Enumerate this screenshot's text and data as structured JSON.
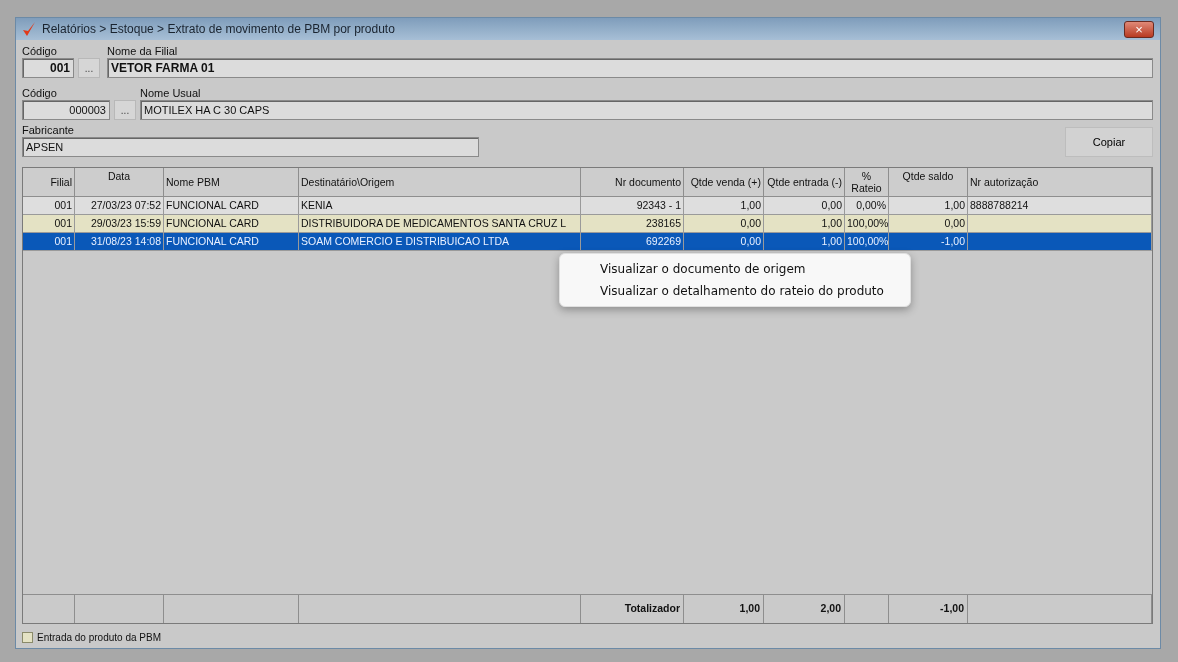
{
  "window": {
    "title": "Relatórios > Estoque > Extrato de movimento de PBM por produto",
    "close": "×"
  },
  "filial": {
    "codigo_label": "Código",
    "codigo": "001",
    "lookup": "...",
    "nome_label": "Nome da Filial",
    "nome": "VETOR FARMA 01"
  },
  "produto": {
    "codigo_label": "Código",
    "codigo": "000003",
    "lookup": "...",
    "nome_label": "Nome Usual",
    "nome": "MOTILEX HA C 30 CAPS",
    "fabricante_label": "Fabricante",
    "fabricante": "APSEN"
  },
  "copy_button": "Copiar",
  "table": {
    "columns": [
      "Filial",
      "Data",
      "Nome PBM",
      "Destinatário\\Origem",
      "Nr documento",
      "Qtde venda (+)",
      "Qtde entrada (-)",
      "% Rateio",
      "Qtde saldo",
      "Nr autorização"
    ],
    "rows": [
      {
        "kind": "saida",
        "selected": false,
        "cells": [
          "001",
          "27/03/23 07:52",
          "FUNCIONAL CARD",
          "KENIA",
          "92343 - 1",
          "1,00",
          "0,00",
          "0,00%",
          "1,00",
          "8888788214"
        ]
      },
      {
        "kind": "entrada",
        "selected": false,
        "cells": [
          "001",
          "29/03/23 15:59",
          "FUNCIONAL CARD",
          "DISTRIBUIDORA DE MEDICAMENTOS SANTA CRUZ L",
          "238165",
          "0,00",
          "1,00",
          "100,00%",
          "0,00",
          ""
        ]
      },
      {
        "selected": true,
        "cells": [
          "001",
          "31/08/23 14:08",
          "FUNCIONAL CARD",
          "SOAM COMERCIO E DISTRIBUICAO LTDA",
          "692269",
          "0,00",
          "1,00",
          "100,00%",
          "-1,00",
          ""
        ]
      }
    ],
    "totals": {
      "label": "Totalizador",
      "qtde_venda": "1,00",
      "qtde_entrada": "2,00",
      "qtde_saldo": "-1,00"
    }
  },
  "legend": {
    "label": "Entrada do produto da PBM"
  },
  "context_menu": {
    "items": [
      "Visualizar o documento de origem",
      "Visualizar o detalhamento do rateio do produto"
    ]
  }
}
